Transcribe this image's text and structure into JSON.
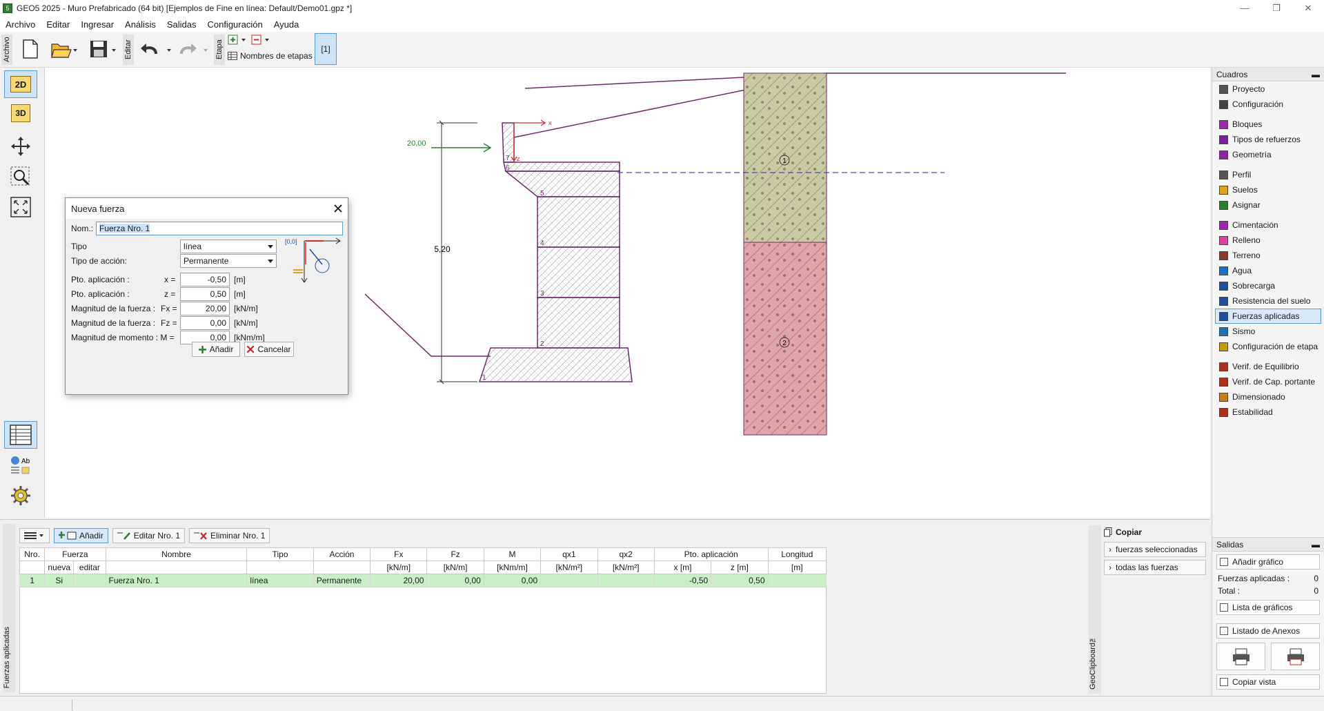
{
  "window": {
    "title": "GEO5 2025 - Muro Prefabricado (64 bit) [Ejemplos de Fine en línea: Default/Demo01.gpz *]",
    "app_icon": "5",
    "minimize": "—",
    "restore": "❐",
    "close": "✕"
  },
  "menu": [
    "Archivo",
    "Editar",
    "Ingresar",
    "Análisis",
    "Salidas",
    "Configuración",
    "Ayuda"
  ],
  "toolbar": {
    "archivo_label": "Archivo",
    "editar_label": "Editar",
    "etapa_label": "Etapa",
    "stage_names_label": "Nombres de etapas",
    "stage_button": "[1]"
  },
  "left_tools": {
    "btn_2d": "2D",
    "btn_3d": "3D"
  },
  "drawing": {
    "force_value": "20,00",
    "height_dim": "5,20",
    "block_labels": [
      "1",
      "2",
      "3",
      "4",
      "5",
      "6",
      "7"
    ],
    "soil_labels": [
      "1",
      "2"
    ],
    "axis_x": "x",
    "axis_z": "z"
  },
  "dialog": {
    "title": "Nueva fuerza",
    "name_label": "Nom.:",
    "name_value": "Fuerza Nro. 1",
    "type_label": "Tipo",
    "type_value": "línea",
    "action_label": "Tipo de acción:",
    "action_value": "Permanente",
    "px_label": "Pto. aplicación :",
    "px_sym": "x  =",
    "px_value": "-0,50",
    "px_unit": "[m]",
    "pz_label": "Pto. aplicación :",
    "pz_sym": "z  =",
    "pz_value": "0,50",
    "pz_unit": "[m]",
    "fx_label": "Magnitud de la fuerza :",
    "fx_sym": "Fx =",
    "fx_value": "20,00",
    "fx_unit": "[kN/m]",
    "fz_label": "Magnitud de la fuerza :",
    "fz_sym": "Fz =",
    "fz_value": "0,00",
    "fz_unit": "[kN/m]",
    "m_label": "Magnitud de momento : M =",
    "m_value": "0,00",
    "m_unit": "[kNm/m]",
    "origin_label": "[0,0]",
    "add_button": "Añadir",
    "cancel_button": "Cancelar"
  },
  "right_panel": {
    "header": "Cuadros",
    "groups": [
      [
        {
          "label": "Proyecto",
          "icon": "doc-icon",
          "color": "#555"
        },
        {
          "label": "Configuración",
          "icon": "gear-icon",
          "color": "#444"
        }
      ],
      [
        {
          "label": "Bloques",
          "icon": "blocks-icon",
          "color": "#9c27b0"
        },
        {
          "label": "Tipos de refuerzos",
          "icon": "reinforcement-icon",
          "color": "#7b1fa2"
        },
        {
          "label": "Geometría",
          "icon": "geometry-icon",
          "color": "#8e24aa"
        }
      ],
      [
        {
          "label": "Perfil",
          "icon": "profile-icon",
          "color": "#555"
        },
        {
          "label": "Suelos",
          "icon": "soils-icon",
          "color": "#e0a020"
        },
        {
          "label": "Asignar",
          "icon": "assign-icon",
          "color": "#2e7d32"
        }
      ],
      [
        {
          "label": "Cimentación",
          "icon": "foundation-icon",
          "color": "#9c27b0"
        },
        {
          "label": "Relleno",
          "icon": "backfill-icon",
          "color": "#e040a0"
        },
        {
          "label": "Terreno",
          "icon": "terrain-icon",
          "color": "#8d3a2a"
        },
        {
          "label": "Agua",
          "icon": "water-icon",
          "color": "#1e6fc0"
        },
        {
          "label": "Sobrecarga",
          "icon": "surcharge-icon",
          "color": "#1e4fa0"
        },
        {
          "label": "Resistencia del suelo",
          "icon": "resistance-icon",
          "color": "#1e4fa0"
        },
        {
          "label": "Fuerzas aplicadas",
          "icon": "forces-icon",
          "color": "#1e4fa0"
        },
        {
          "label": "Sismo",
          "icon": "earthquake-icon",
          "color": "#1e6fc0"
        },
        {
          "label": "Configuración de etapa",
          "icon": "stage-settings-icon",
          "color": "#c0a000"
        }
      ],
      [
        {
          "label": "Verif. de Equilibrio",
          "icon": "equilibrium-icon",
          "color": "#b03020"
        },
        {
          "label": "Verif. de Cap. portante",
          "icon": "bearing-icon",
          "color": "#b03020"
        },
        {
          "label": "Dimensionado",
          "icon": "dimension-icon",
          "color": "#c08020"
        },
        {
          "label": "Estabilidad",
          "icon": "stability-icon",
          "color": "#b03020"
        }
      ]
    ],
    "selected": "Fuerzas aplicadas"
  },
  "outputs": {
    "header": "Salidas",
    "add_graph": "Añadir gráfico",
    "forces_label": "Fuerzas aplicadas :",
    "forces_value": "0",
    "total_label": "Total :",
    "total_value": "0",
    "graph_list": "Lista de gráficos",
    "annex_list": "Listado de Anexos",
    "copy_view": "Copiar vista"
  },
  "bottom": {
    "side_tab": "Fuerzas aplicadas",
    "add_button": "Añadir",
    "edit_button": "Editar Nro. 1",
    "delete_button": "Eliminar Nro. 1",
    "columns_top": [
      "Nro.",
      "Fuerza",
      "Nombre",
      "Tipo",
      "Acción",
      "Fx",
      "Fz",
      "M",
      "qx1",
      "qx2",
      "Pto. aplicación",
      "Longitud"
    ],
    "columns_sub": [
      "nueva",
      "editar",
      "[kN/m]",
      "[kN/m]",
      "[kNm/m]",
      "[kN/m²]",
      "[kN/m²]",
      "x [m]",
      "z [m]",
      "[m]"
    ],
    "rows": [
      [
        "1",
        "Si",
        "",
        "Fuerza Nro. 1",
        "línea",
        "Permanente",
        "20,00",
        "0,00",
        "0,00",
        "",
        "",
        "-0,50",
        "0,50",
        ""
      ]
    ],
    "clip_tab": "GeoClipboard™",
    "copy_label": "Copiar",
    "copy_selected": "fuerzas seleccionadas",
    "copy_all": "todas las fuerzas"
  }
}
